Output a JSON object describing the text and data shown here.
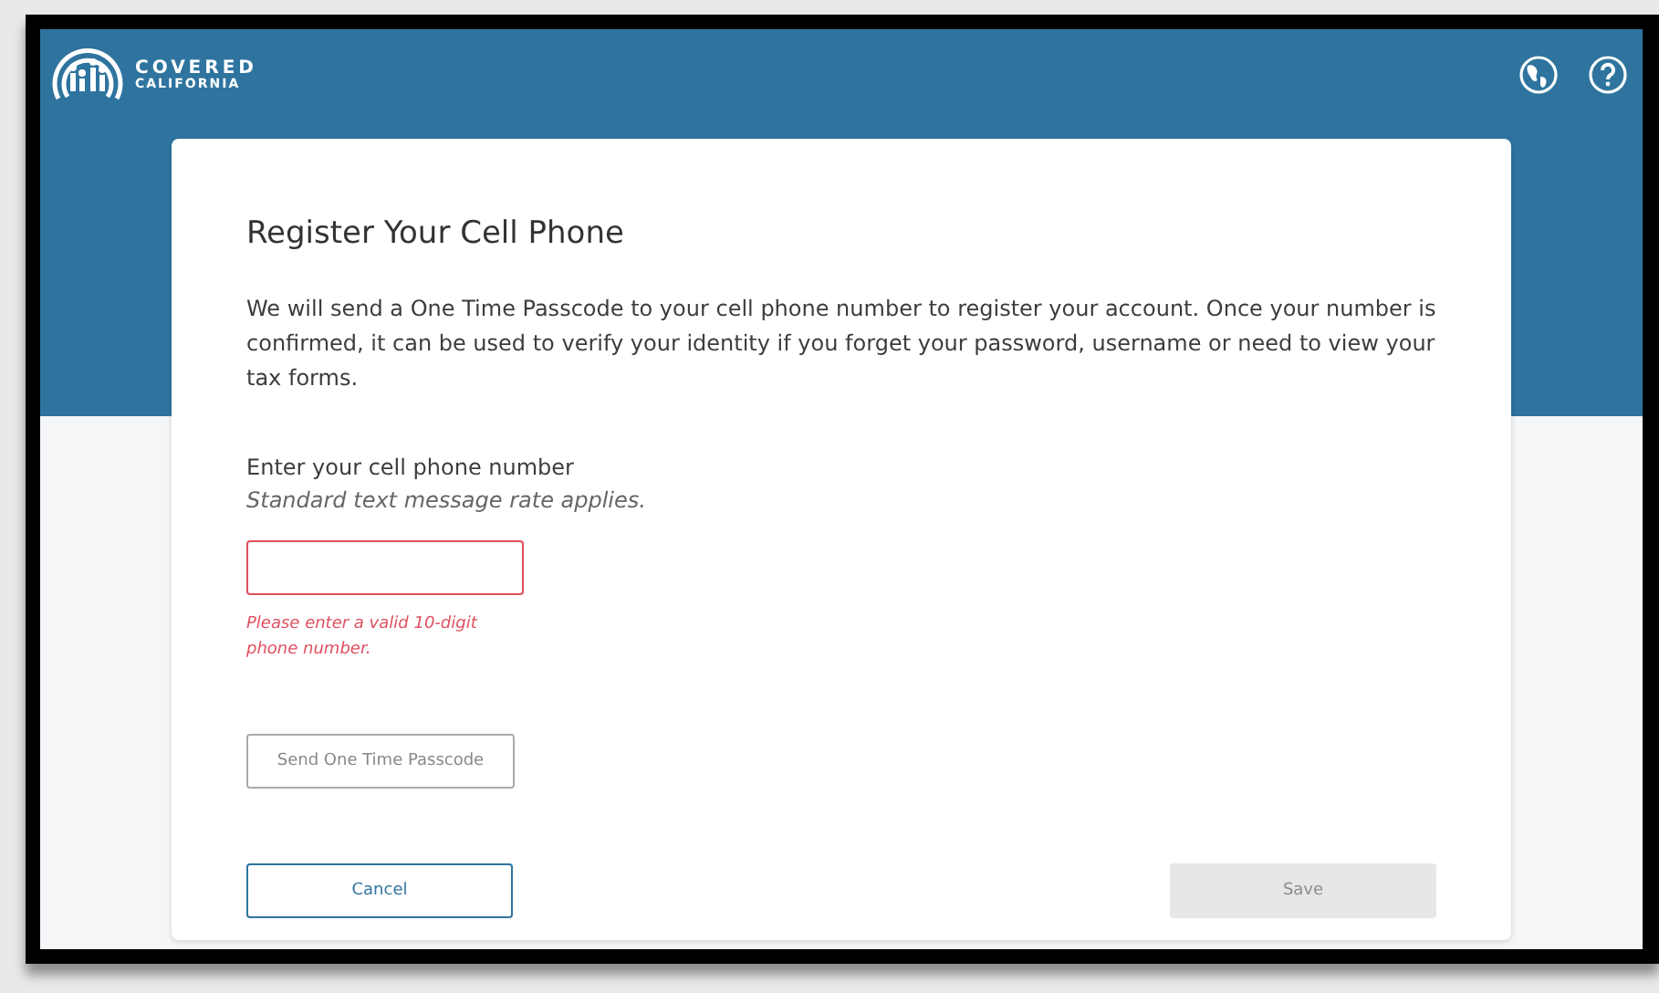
{
  "header": {
    "logo": {
      "line_1": "COVERED",
      "line_2": "CALIFORNIA"
    }
  },
  "card": {
    "title": "Register Your Cell Phone",
    "description": "We will send a One Time Passcode to your cell phone number to register your account. Once your number is confirmed, it can be used to verify your identity if you forget your password, username or need to view your tax forms.",
    "phone_field": {
      "label": "Enter your cell phone number",
      "hint": "Standard text message rate applies.",
      "invalid": true,
      "error": "Please enter a valid 10-digit phone number."
    },
    "send_button": {
      "label": "Send One Time Passcode",
      "disabled": true
    },
    "cancel_button": {
      "label": "Cancel",
      "disabled": false
    },
    "save_button": {
      "label": "Save",
      "disabled": true
    }
  }
}
